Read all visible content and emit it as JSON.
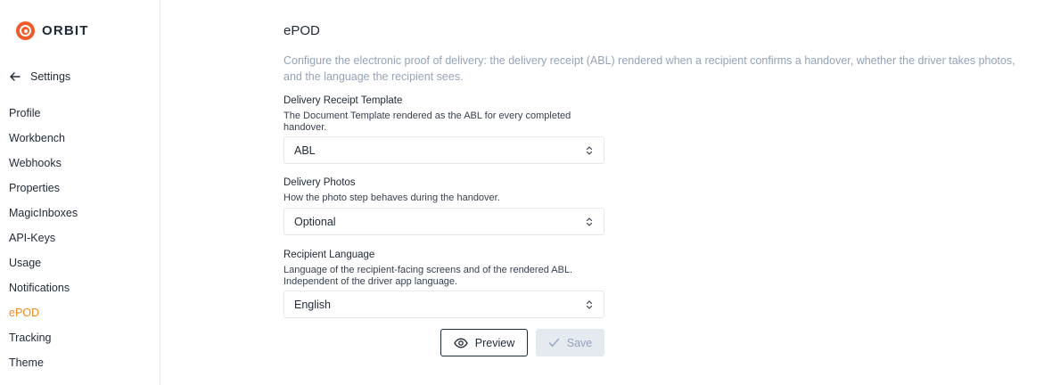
{
  "app": {
    "name": "ORBIT",
    "brand_color": "#f05a28"
  },
  "sidebar": {
    "back_label": "Settings",
    "active_color": "#f28c1e",
    "items": [
      {
        "label": "Profile"
      },
      {
        "label": "Workbench"
      },
      {
        "label": "Webhooks"
      },
      {
        "label": "Properties"
      },
      {
        "label": "MagicInboxes"
      },
      {
        "label": "API-Keys"
      },
      {
        "label": "Usage"
      },
      {
        "label": "Notifications"
      },
      {
        "label": "ePOD",
        "active": true
      },
      {
        "label": "Tracking"
      },
      {
        "label": "Theme"
      }
    ]
  },
  "main": {
    "title": "ePOD",
    "description": "Configure the electronic proof of delivery: the delivery receipt (ABL) rendered when a recipient confirms a handover, whether the driver takes photos, and the language the recipient sees.",
    "fields": [
      {
        "label": "Delivery Receipt Template",
        "help": "The Document Template rendered as the ABL for every completed handover.",
        "value": "ABL"
      },
      {
        "label": "Delivery Photos",
        "help": "How the photo step behaves during the handover.",
        "value": "Optional"
      },
      {
        "label": "Recipient Language",
        "help": "Language of the recipient-facing screens and of the rendered ABL. Independent of the driver app language.",
        "value": "English"
      }
    ],
    "actions": {
      "preview_label": "Preview",
      "save_label": "Save",
      "save_disabled": true
    }
  }
}
